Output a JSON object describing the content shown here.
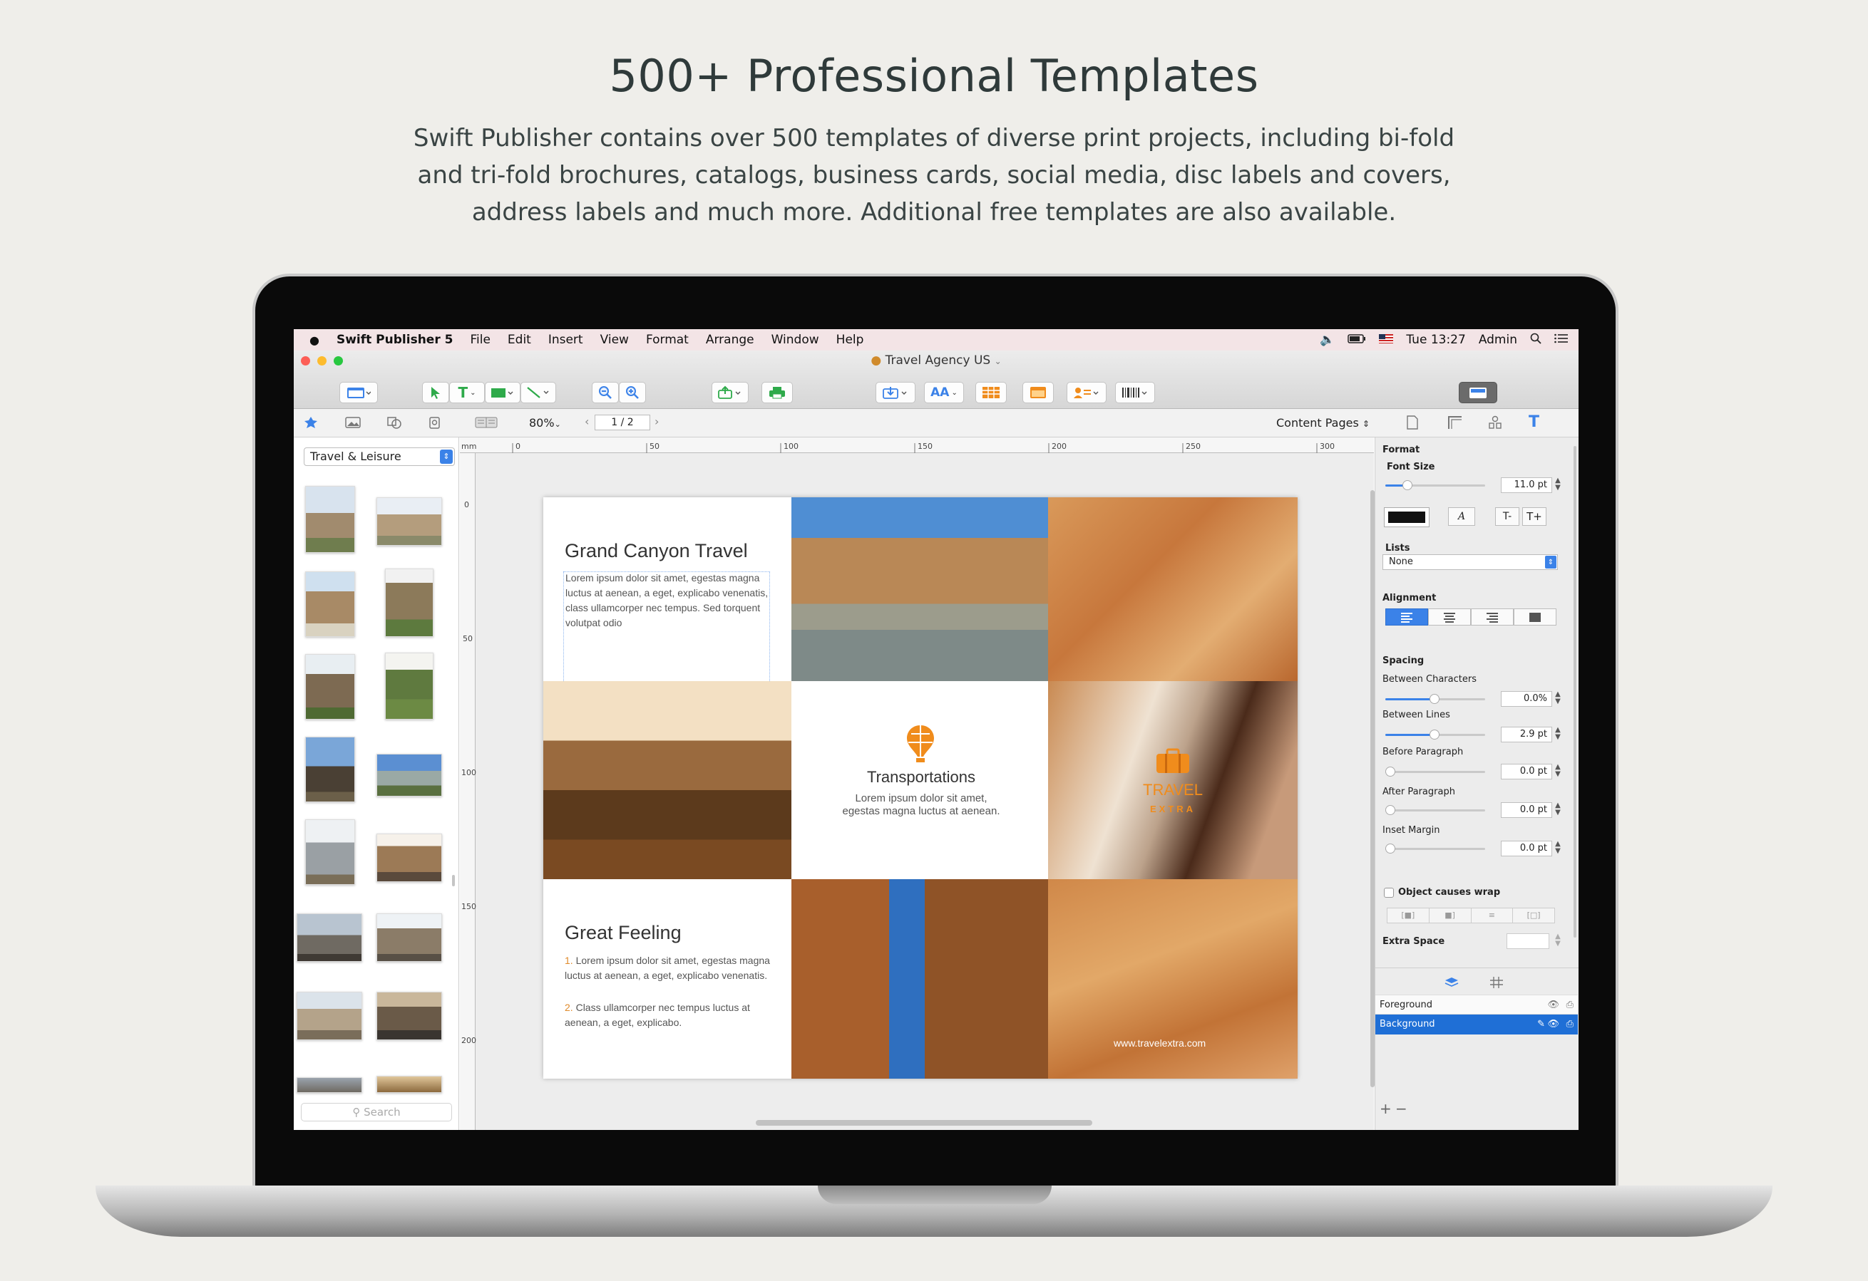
{
  "hero": {
    "heading": "500+ Professional Templates",
    "description": "Swift Publisher contains over 500 templates of diverse print projects, including bi-fold and tri-fold brochures, catalogs, business cards, social media, disc labels and covers, address labels and much more. Additional free templates are also available."
  },
  "menubar": {
    "app_name": "Swift Publisher 5",
    "items": [
      "File",
      "Edit",
      "Insert",
      "View",
      "Format",
      "Arrange",
      "Window",
      "Help"
    ],
    "clock": "Tue 13:27",
    "user": "Admin"
  },
  "window": {
    "title": "Travel Agency US"
  },
  "toolbar": {
    "zoom": "80%",
    "page_indicator": "1 / 2",
    "pages_selector": "Content Pages"
  },
  "left_panel": {
    "category": "Travel & Leisure",
    "search_placeholder": "Search"
  },
  "ruler": {
    "unit": "mm",
    "h_labels": [
      "0",
      "50",
      "100",
      "150",
      "200",
      "250",
      "300"
    ],
    "v_labels": [
      "0",
      "50",
      "100",
      "150",
      "200"
    ]
  },
  "document": {
    "panel1_title": "Grand Canyon Travel",
    "panel1_body": "Lorem ipsum dolor sit amet, egestas magna luctus at aenean, a eget, explicabo venenatis, class ullamcorper nec tempus. Sed torquent volutpat odio",
    "center_title": "Transportations",
    "center_body": "Lorem ipsum dolor sit amet, egestas magna luctus at aenean.",
    "brand_name": "TRAVEL",
    "brand_sub": "EXTRA",
    "website": "www.travelextra.com",
    "panel3_title": "Great Feeling",
    "list_item1_num": "1.",
    "list_item1": "Lorem ipsum dolor sit amet, egestas magna luctus at aenean, a eget, explicabo venenatis.",
    "list_item2_num": "2.",
    "list_item2": "Class ullamcorper nec tempus luctus at aenean, a eget, explicabo."
  },
  "inspector": {
    "format_label": "Format",
    "font_size_label": "Font Size",
    "font_size": "11.0 pt",
    "lists_label": "Lists",
    "lists_value": "None",
    "alignment_label": "Alignment",
    "spacing_label": "Spacing",
    "between_characters_label": "Between Characters",
    "between_characters": "0.0%",
    "between_lines_label": "Between Lines",
    "between_lines": "2.9 pt",
    "before_paragraph_label": "Before Paragraph",
    "before_paragraph": "0.0 pt",
    "after_paragraph_label": "After Paragraph",
    "after_paragraph": "0.0 pt",
    "inset_margin_label": "Inset Margin",
    "inset_margin": "0.0 pt",
    "wrap_label": "Object causes wrap",
    "extra_space_label": "Extra Space",
    "layers": [
      "Foreground",
      "Background"
    ]
  },
  "colors": {
    "accent": "#3b82e8",
    "brand_orange": "#f08c1c",
    "page_bg": "#efeeea"
  }
}
